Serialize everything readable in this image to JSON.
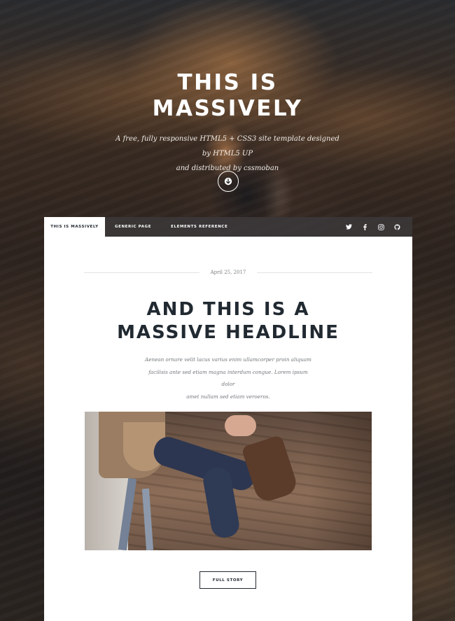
{
  "hero": {
    "title_line1": "THIS IS",
    "title_line2": "MASSIVELY",
    "subtitle_line1": "A free, fully responsive HTML5 + CSS3 site template designed by HTML5 UP",
    "subtitle_line2": "and distributed by cssmoban",
    "scroll_icon": "arrow-down-circle-icon"
  },
  "nav": {
    "items": [
      {
        "label": "THIS IS MASSIVELY",
        "active": true
      },
      {
        "label": "GENERIC PAGE",
        "active": false
      },
      {
        "label": "ELEMENTS REFERENCE",
        "active": false
      }
    ],
    "social_icons": [
      "twitter-icon",
      "facebook-icon",
      "instagram-icon",
      "github-icon"
    ]
  },
  "post": {
    "date": "April 25, 2017",
    "headline_line1": "AND THIS IS A",
    "headline_line2": "MASSIVE HEADLINE",
    "body_line1": "Aenean ornare velit lacus varius enim ullamcorper proin aliquam",
    "body_line2": "facilisis ante sed etiam magna interdum congue. Lorem ipsum dolor",
    "body_line3": "amet nullam sed etiam veroeros.",
    "cta_label": "FULL STORY"
  },
  "colors": {
    "text_dark": "#212931",
    "white": "#ffffff",
    "nav_bg": "#3c3a3c"
  }
}
